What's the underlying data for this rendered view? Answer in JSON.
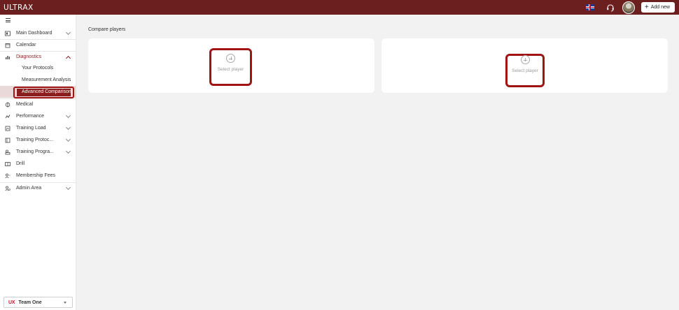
{
  "header": {
    "logo": "ULTRAX",
    "add_new_label": "Add new",
    "language_icon": "uk-flag-icon",
    "support_icon": "headset-icon"
  },
  "sidebar": {
    "items": [
      {
        "label": "Main Dashboard",
        "icon": "dashboard-icon",
        "expandable": true
      },
      {
        "label": "Calendar",
        "icon": "calendar-icon",
        "expandable": false
      },
      {
        "label": "Diagnostics",
        "icon": "chart-icon",
        "expandable": true,
        "expanded": true,
        "children": [
          {
            "label": "Your Protocols"
          },
          {
            "label": "Measurement Analysis"
          },
          {
            "label": "Advanced Comparison",
            "selected": true
          }
        ]
      },
      {
        "label": "Medical",
        "icon": "medical-icon",
        "expandable": false
      },
      {
        "label": "Performance",
        "icon": "performance-icon",
        "expandable": true
      },
      {
        "label": "Training Load",
        "icon": "load-icon",
        "expandable": true
      },
      {
        "label": "Training Protoc...",
        "icon": "protocol-icon",
        "expandable": true
      },
      {
        "label": "Training Progra...",
        "icon": "program-icon",
        "expandable": true
      },
      {
        "label": "Drill",
        "icon": "drill-icon",
        "expandable": false
      },
      {
        "label": "Membership Fees",
        "icon": "fees-icon",
        "expandable": false
      },
      {
        "label": "Admin Area",
        "icon": "admin-icon",
        "expandable": true
      }
    ],
    "team": {
      "badge": "UX",
      "name": "Team One"
    }
  },
  "main": {
    "title": "Compare players",
    "slots": [
      {
        "label": "Select player"
      },
      {
        "label": "Select player"
      }
    ]
  },
  "colors": {
    "brand": "#6b1f1f",
    "highlight": "#a11414",
    "background": "#f3f2f2"
  }
}
